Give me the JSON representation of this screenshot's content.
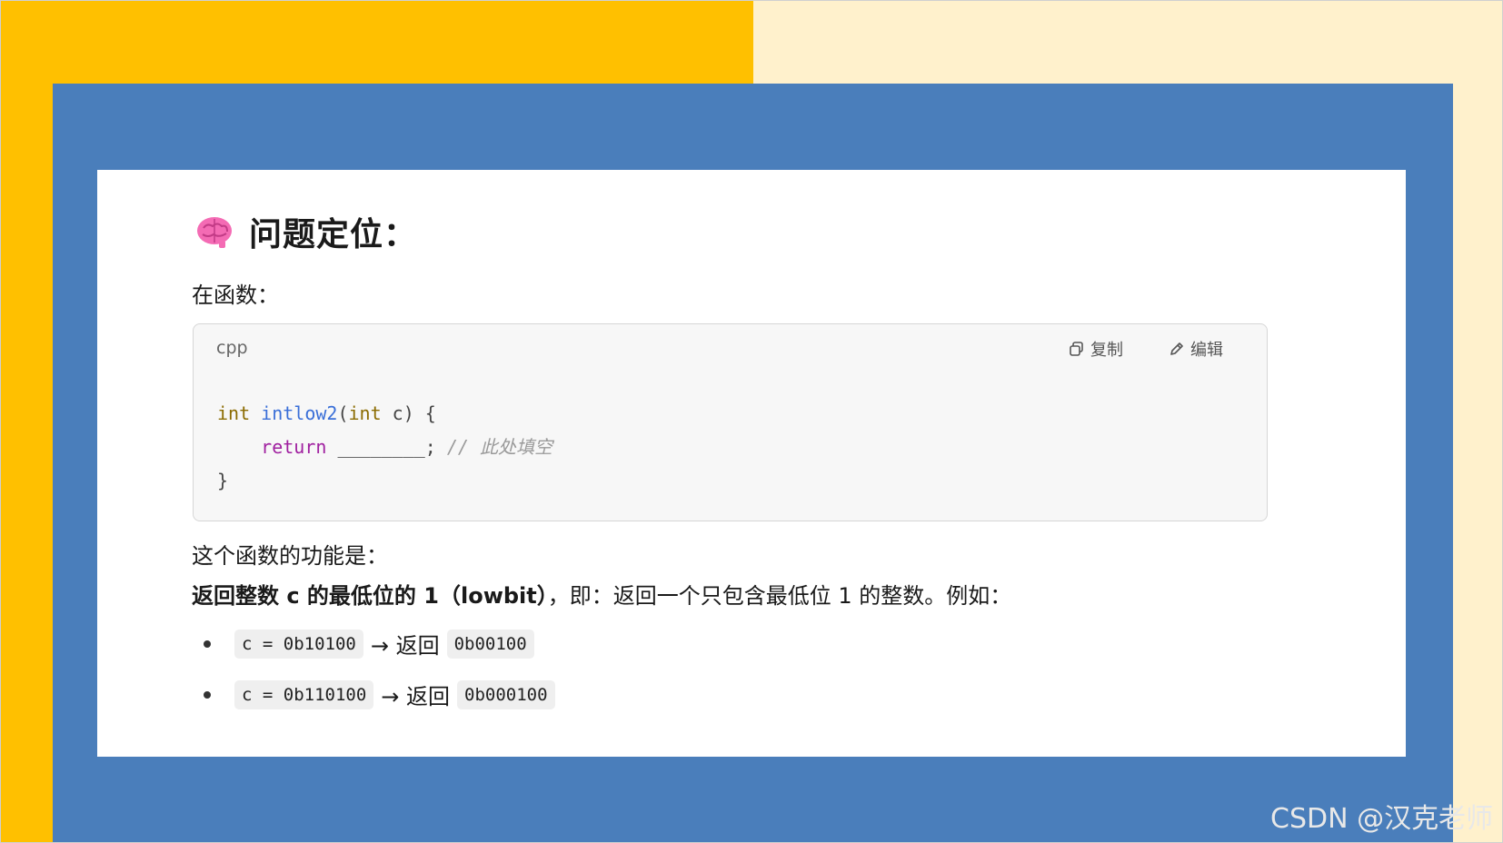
{
  "heading": {
    "title": "问题定位："
  },
  "intro": {
    "text": "在函数："
  },
  "code": {
    "lang": "cpp",
    "copy_label": "复制",
    "edit_label": "编辑",
    "line1": {
      "type": "int",
      "fn": "intlow2",
      "open": "(",
      "param_type": "int",
      "param": " c) {"
    },
    "line2": {
      "indent": "    ",
      "kw": "return",
      "blank": " ________;",
      "comment": " // 此处填空"
    },
    "line3": {
      "text": "}"
    }
  },
  "description": {
    "line1": "这个函数的功能是：",
    "bold": "返回整数 c 的最低位的 1（lowbit）",
    "rest": "，即：返回一个只包含最低位 1 的整数。例如："
  },
  "examples": [
    {
      "input": "c = 0b10100",
      "arrow": "→ 返回",
      "output": "0b00100"
    },
    {
      "input": "c = 0b110100",
      "arrow": "→ 返回",
      "output": "0b000100"
    }
  ],
  "watermark": "CSDN @汉克老师",
  "colors": {
    "yellow": "#ffc000",
    "cream": "#fff1cc",
    "blue": "#4a7ebb"
  }
}
